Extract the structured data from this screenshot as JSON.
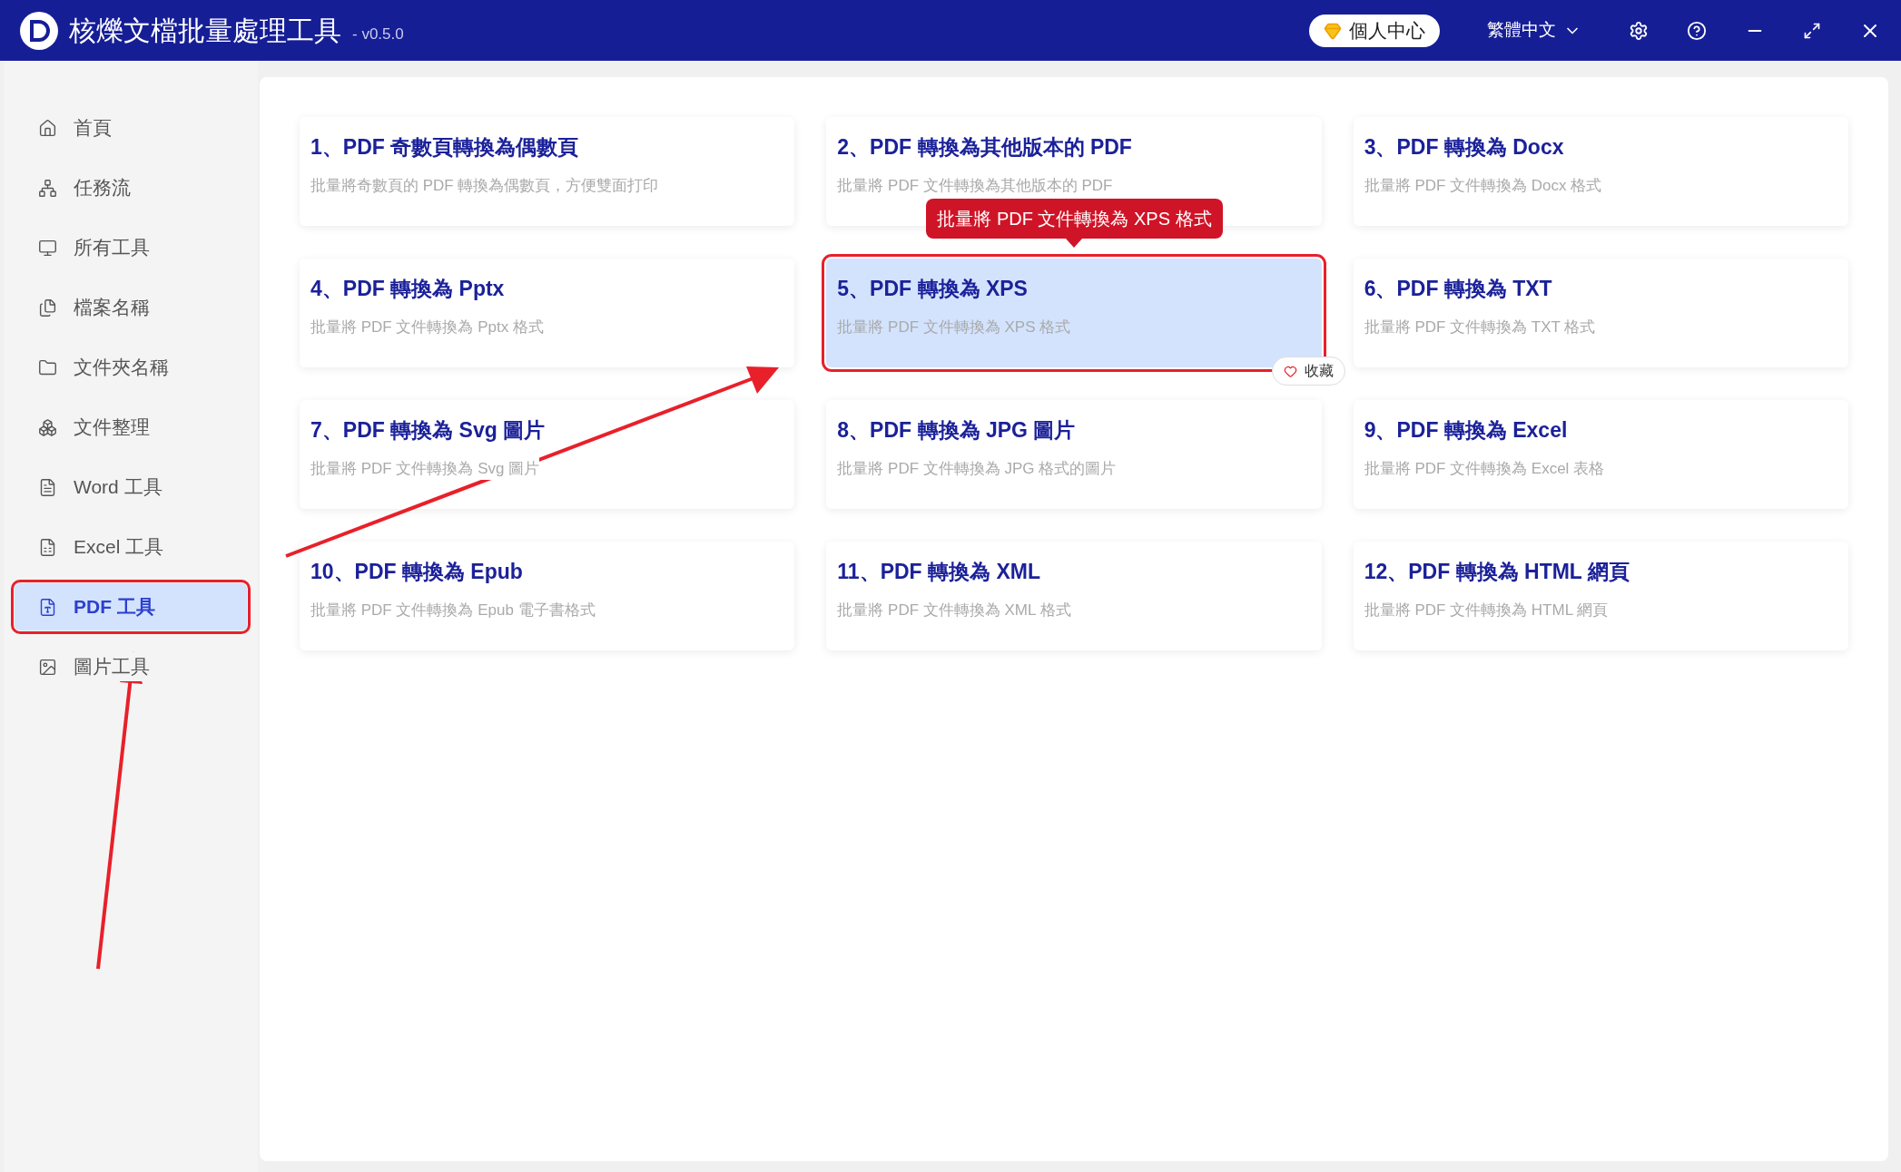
{
  "window": {
    "title": "核爍文檔批量處理工具",
    "version": "- v0.5.0",
    "account_button": "個人中心",
    "language": "繁體中文"
  },
  "sidebar": {
    "items": [
      {
        "label": "首頁",
        "selected": false
      },
      {
        "label": "任務流",
        "selected": false
      },
      {
        "label": "所有工具",
        "selected": false
      },
      {
        "label": "檔案名稱",
        "selected": false
      },
      {
        "label": "文件夾名稱",
        "selected": false
      },
      {
        "label": "文件整理",
        "selected": false
      },
      {
        "label": "Word 工具",
        "selected": false
      },
      {
        "label": "Excel 工具",
        "selected": false
      },
      {
        "label": "PDF 工具",
        "selected": true
      },
      {
        "label": "圖片工具",
        "selected": false
      }
    ]
  },
  "tools": [
    {
      "title": "1、PDF 奇數頁轉換為偶數頁",
      "description": "批量將奇數頁的 PDF 轉換為偶數頁，方便雙面打印",
      "selected": false
    },
    {
      "title": "2、PDF 轉換為其他版本的 PDF",
      "description": "批量將 PDF 文件轉換為其他版本的 PDF",
      "selected": false
    },
    {
      "title": "3、PDF 轉換為 Docx",
      "description": "批量將 PDF 文件轉換為 Docx 格式",
      "selected": false
    },
    {
      "title": "4、PDF 轉換為 Pptx",
      "description": "批量將 PDF 文件轉換為 Pptx 格式",
      "selected": false
    },
    {
      "title": "5、PDF 轉換為 XPS",
      "description": "批量將 PDF 文件轉換為 XPS 格式",
      "selected": true
    },
    {
      "title": "6、PDF 轉換為 TXT",
      "description": "批量將 PDF 文件轉換為 TXT 格式",
      "selected": false
    },
    {
      "title": "7、PDF 轉換為 Svg 圖片",
      "description": "批量將 PDF 文件轉換為 Svg 圖片",
      "selected": false
    },
    {
      "title": "8、PDF 轉換為 JPG 圖片",
      "description": "批量將 PDF 文件轉換為 JPG 格式的圖片",
      "selected": false
    },
    {
      "title": "9、PDF 轉換為 Excel",
      "description": "批量將 PDF 文件轉換為 Excel 表格",
      "selected": false
    },
    {
      "title": "10、PDF 轉換為 Epub",
      "description": "批量將 PDF 文件轉換為 Epub 電子書格式",
      "selected": false
    },
    {
      "title": "11、PDF 轉換為 XML",
      "description": "批量將 PDF 文件轉換為 XML 格式",
      "selected": false
    },
    {
      "title": "12、PDF 轉換為 HTML 網頁",
      "description": "批量將 PDF 文件轉換為 HTML 網頁",
      "selected": false
    }
  ],
  "tooltip": "批量將 PDF 文件轉換為 XPS 格式",
  "favorite_button": "收藏"
}
